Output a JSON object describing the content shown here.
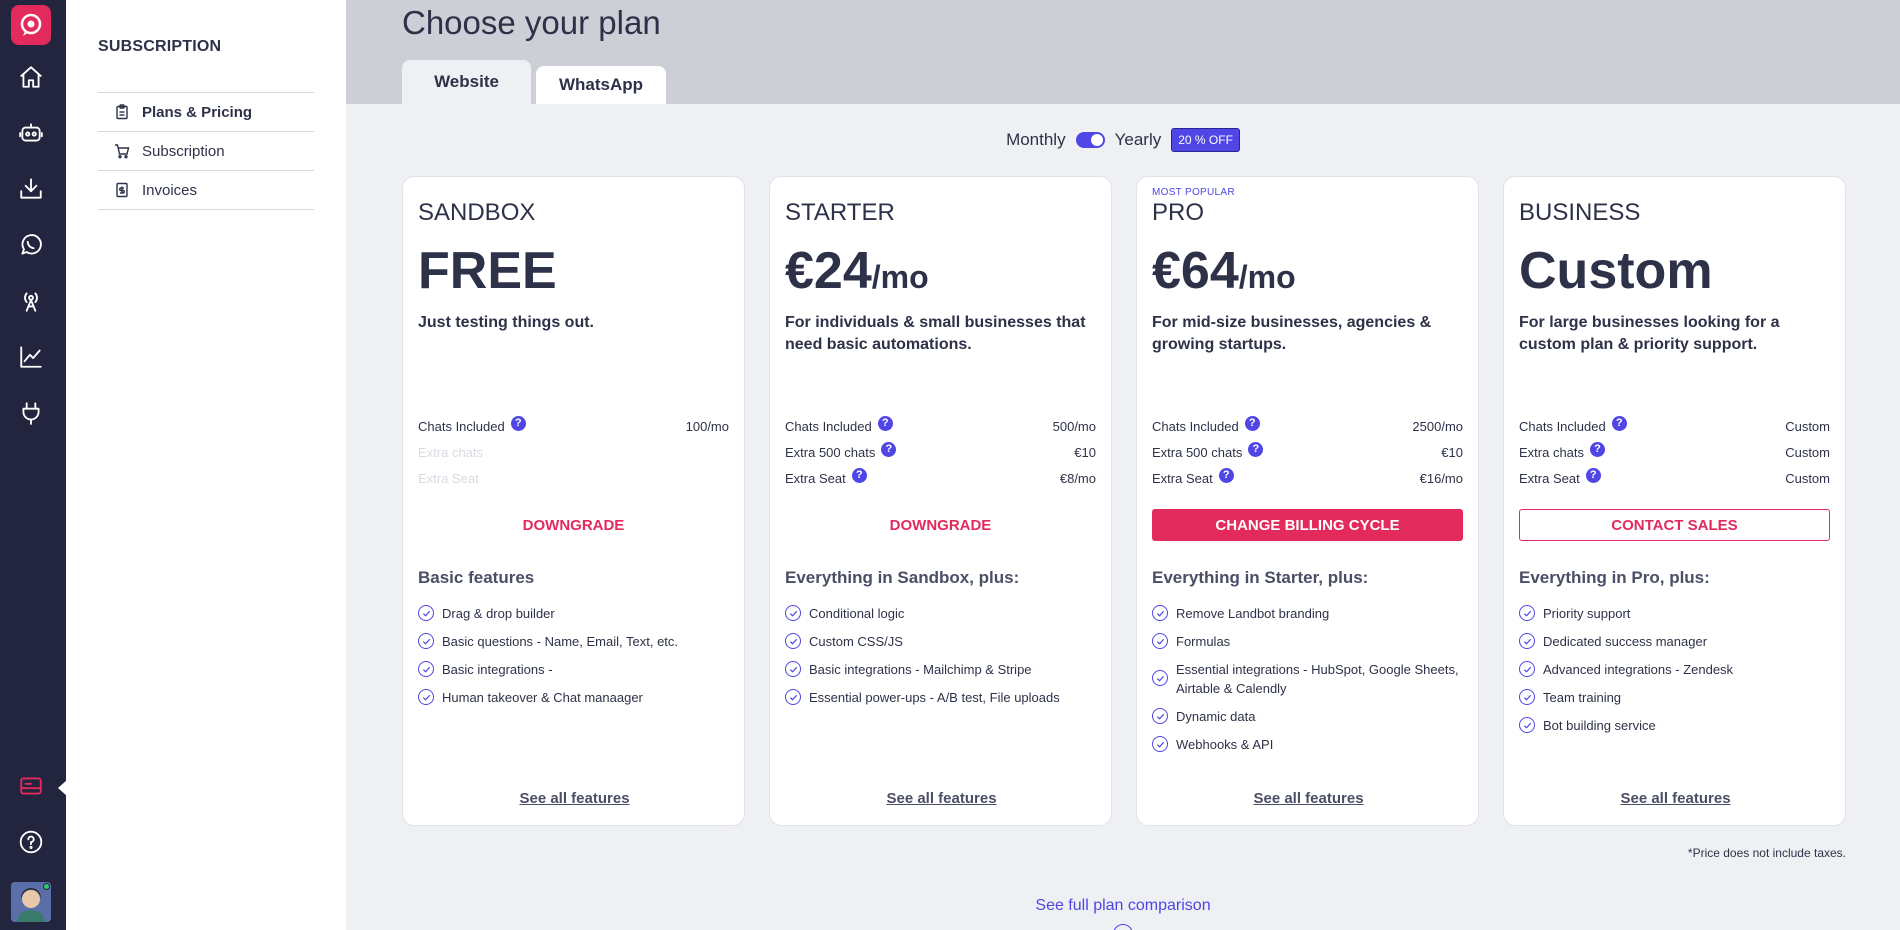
{
  "nav": {
    "items": [
      "home-icon",
      "bot-icon",
      "inbox-icon",
      "whatsapp-icon",
      "broadcast-icon",
      "analytics-icon",
      "integrations-icon"
    ],
    "bottom": [
      "billing-icon",
      "help-icon"
    ]
  },
  "sidebar": {
    "title": "SUBSCRIPTION",
    "items": [
      {
        "label": "Plans & Pricing",
        "icon": "clipboard-icon"
      },
      {
        "label": "Subscription",
        "icon": "cart-icon"
      },
      {
        "label": "Invoices",
        "icon": "invoice-icon"
      }
    ]
  },
  "header": {
    "title": "Choose your plan",
    "tabs": [
      "Website",
      "WhatsApp"
    ]
  },
  "billing": {
    "monthly": "Monthly",
    "yearly": "Yearly",
    "discount": "20 % OFF",
    "yearly_selected": true
  },
  "plans": [
    {
      "badge": "",
      "name": "SANDBOX",
      "price": "FREE",
      "per": "",
      "description": "Just testing things out.",
      "limits": [
        {
          "label": "Chats Included",
          "value": "100/mo"
        },
        {
          "label": "Extra chats",
          "value": ""
        },
        {
          "label": "Extra Seat",
          "value": ""
        }
      ],
      "action": "DOWNGRADE",
      "features_title": "Basic features",
      "features": [
        "Drag & drop builder",
        "Basic questions - Name, Email, Text, etc.",
        "Basic integrations -",
        "Human takeover & Chat manaager"
      ],
      "see_all": "See all features"
    },
    {
      "badge": "",
      "name": "STARTER",
      "price": "€24",
      "per": "/mo",
      "description": "For individuals & small businesses that need basic automations.",
      "limits": [
        {
          "label": "Chats Included",
          "value": "500/mo"
        },
        {
          "label": "Extra 500 chats",
          "value": "€10"
        },
        {
          "label": "Extra Seat",
          "value": "€8/mo"
        }
      ],
      "action": "DOWNGRADE",
      "features_title": "Everything in Sandbox, plus:",
      "features": [
        "Conditional logic",
        "Custom CSS/JS",
        "Basic integrations - Mailchimp & Stripe",
        "Essential power-ups - A/B test, File uploads"
      ],
      "see_all": "See all features"
    },
    {
      "badge": "MOST POPULAR",
      "name": "PRO",
      "price": "€64",
      "per": "/mo",
      "description": "For mid-size businesses, agencies & growing startups.",
      "limits": [
        {
          "label": "Chats Included",
          "value": "2500/mo"
        },
        {
          "label": "Extra 500 chats",
          "value": "€10"
        },
        {
          "label": "Extra Seat",
          "value": "€16/mo"
        }
      ],
      "action": "CHANGE BILLING CYCLE",
      "features_title": "Everything in Starter, plus:",
      "features": [
        "Remove Landbot branding",
        "Formulas",
        "Essential integrations - HubSpot, Google Sheets, Airtable & Calendly",
        "Dynamic data",
        "Webhooks & API"
      ],
      "see_all": "See all features"
    },
    {
      "badge": "",
      "name": "BUSINESS",
      "price": "Custom",
      "per": "",
      "description": "For large businesses looking for a custom plan & priority support.",
      "limits": [
        {
          "label": "Chats Included",
          "value": "Custom"
        },
        {
          "label": "Extra chats",
          "value": "Custom"
        },
        {
          "label": "Extra Seat",
          "value": "Custom"
        }
      ],
      "action": "CONTACT SALES",
      "features_title": "Everything in Pro, plus:",
      "features": [
        "Priority support",
        "Dedicated success manager",
        "Advanced integrations - Zendesk",
        "Team training",
        "Bot building service"
      ],
      "see_all": "See all features"
    }
  ],
  "footer": {
    "tax_note": "*Price does not include taxes.",
    "compare": "See full plan comparison"
  },
  "colors": {
    "accent": "#4f46e5",
    "brand": "#e32a5d",
    "rail": "#22253d"
  }
}
